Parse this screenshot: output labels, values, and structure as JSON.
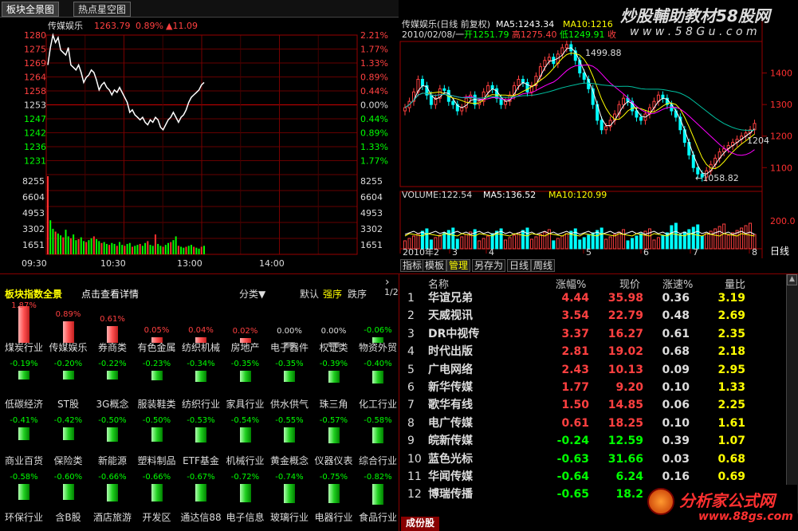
{
  "tabs": [
    "板块全景图",
    "热点星空图"
  ],
  "intraday": {
    "name": "传媒娱乐",
    "price": "1263.79",
    "pct": "0.89%",
    "change": "▲11.09",
    "price_ticks": [
      "1280",
      "1275",
      "1269",
      "1264",
      "1258",
      "1253",
      "1247",
      "1242",
      "1236",
      "1231"
    ],
    "pct_ticks": [
      "2.21%",
      "1.77%",
      "1.33%",
      "0.89%",
      "0.44%",
      "0.00%",
      "0.44%",
      "0.89%",
      "1.33%",
      "1.77%"
    ],
    "vol_ticks": [
      "8255",
      "6604",
      "4953",
      "3302",
      "1651"
    ],
    "time_ticks": [
      "09:30",
      "10:30",
      "13:00",
      "14:00"
    ],
    "price_series": [
      1270,
      1277,
      1282,
      1279,
      1281,
      1276,
      1275,
      1274,
      1277,
      1270,
      1269,
      1268,
      1270,
      1267,
      1263,
      1265,
      1266,
      1268,
      1267,
      1264,
      1260,
      1262,
      1263,
      1261,
      1260,
      1258,
      1260,
      1259,
      1261,
      1259,
      1257,
      1255,
      1251,
      1252,
      1250,
      1249,
      1248,
      1249,
      1247,
      1246,
      1248,
      1247,
      1249,
      1248,
      1245,
      1244,
      1246,
      1248,
      1249,
      1251,
      1249,
      1247,
      1249,
      1250,
      1252,
      1255,
      1257,
      1258,
      1259,
      1260,
      1262,
      1263
    ],
    "vol_series": [
      8255,
      3600,
      2700,
      2400,
      2200,
      2000,
      1800,
      2600,
      1900,
      1700,
      2100,
      1500,
      1600,
      1800,
      1400,
      1300,
      1500,
      1700,
      1900,
      1600,
      1400,
      1200,
      1300,
      1100,
      1000,
      1200,
      1100,
      900,
      1300,
      1000,
      900,
      1100,
      1200,
      800,
      900,
      1000,
      1100,
      900,
      1200,
      1400,
      1000,
      900,
      2100,
      1100,
      900,
      800,
      1000,
      1200,
      1300,
      1500,
      1900,
      900,
      800,
      700,
      800,
      900,
      1000,
      800,
      700,
      600,
      800,
      900
    ]
  },
  "daily": {
    "title": "传媒娱乐(日线 前复权)",
    "ma5": "MA5:1243.34",
    "ma10": "MA10:1216",
    "date_line": "2010/02/08/一",
    "open": "开1251.79",
    "high": "高1275.40",
    "low": "低1249.91",
    "close_lbl": "收",
    "high_note": "1499.88",
    "low_note": "←1058.82",
    "right_note": "1204",
    "y_ticks": [
      "1400",
      "1300",
      "1200",
      "1100"
    ],
    "vol_title": "VOLUME:122.54",
    "vol_ma5": "MA5:136.52",
    "vol_ma10": "MA10:120.99",
    "vol_tick": "200.0",
    "month_ticks": [
      "2010年2",
      "3",
      "4",
      "5",
      "6",
      "7",
      "8"
    ],
    "period_label": "日线",
    "candles": [
      1290,
      1310,
      1340,
      1380,
      1360,
      1330,
      1300,
      1320,
      1350,
      1345,
      1310,
      1300,
      1280,
      1290,
      1320,
      1330,
      1300,
      1310,
      1340,
      1360,
      1350,
      1320,
      1300,
      1310,
      1330,
      1360,
      1380,
      1370,
      1340,
      1360,
      1390,
      1420,
      1440,
      1450,
      1430,
      1460,
      1480,
      1490,
      1470,
      1440,
      1400,
      1380,
      1350,
      1300,
      1250,
      1220,
      1230,
      1250,
      1270,
      1300,
      1320,
      1310,
      1280,
      1260,
      1250,
      1270,
      1290,
      1310,
      1330,
      1320,
      1300,
      1280,
      1260,
      1220,
      1180,
      1140,
      1100,
      1080,
      1070,
      1090,
      1110,
      1130,
      1150,
      1160,
      1170,
      1180,
      1190,
      1200,
      1210,
      1220,
      1240
    ]
  },
  "bottom_tabs": [
    "指标",
    "模板",
    "管理",
    "另存为",
    "日线",
    "周线"
  ],
  "sector": {
    "title": "板块指数全景",
    "subtitle": "点击查看详情",
    "sort_label": "分类▼",
    "opt_default": "默认",
    "opt_strong": "强序",
    "opt_weak": "跌序",
    "page": "1/2",
    "arrow": "›",
    "tiles": [
      {
        "pct": "1.87%",
        "name": "煤炭行业",
        "v": 1.87
      },
      {
        "pct": "0.89%",
        "name": "传媒娱乐",
        "v": 0.89
      },
      {
        "pct": "0.61%",
        "name": "券商类",
        "v": 0.61
      },
      {
        "pct": "0.05%",
        "name": "有色金属",
        "v": 0.05
      },
      {
        "pct": "0.04%",
        "name": "纺织机械",
        "v": 0.04
      },
      {
        "pct": "0.02%",
        "name": "房地产",
        "v": 0.02
      },
      {
        "pct": "0.00%",
        "name": "电子器件",
        "v": 0.0
      },
      {
        "pct": "0.00%",
        "name": "权证类",
        "v": 0.0
      },
      {
        "pct": "-0.06%",
        "name": "物资外贸",
        "v": -0.06
      },
      {
        "pct": "-0.19%",
        "name": "低碳经济",
        "v": -0.19
      },
      {
        "pct": "-0.20%",
        "name": "ST股",
        "v": -0.2
      },
      {
        "pct": "-0.22%",
        "name": "3G概念",
        "v": -0.22
      },
      {
        "pct": "-0.23%",
        "name": "服装鞋类",
        "v": -0.23
      },
      {
        "pct": "-0.34%",
        "name": "纺织行业",
        "v": -0.34
      },
      {
        "pct": "-0.35%",
        "name": "家具行业",
        "v": -0.35
      },
      {
        "pct": "-0.35%",
        "name": "供水供气",
        "v": -0.35
      },
      {
        "pct": "-0.39%",
        "name": "珠三角",
        "v": -0.39
      },
      {
        "pct": "-0.40%",
        "name": "化工行业",
        "v": -0.4
      },
      {
        "pct": "-0.41%",
        "name": "商业百货",
        "v": -0.41
      },
      {
        "pct": "-0.42%",
        "name": "保险类",
        "v": -0.42
      },
      {
        "pct": "-0.50%",
        "name": "新能源",
        "v": -0.5
      },
      {
        "pct": "-0.50%",
        "name": "塑料制品",
        "v": -0.5
      },
      {
        "pct": "-0.53%",
        "name": "ETF基金",
        "v": -0.53
      },
      {
        "pct": "-0.54%",
        "name": "机械行业",
        "v": -0.54
      },
      {
        "pct": "-0.55%",
        "name": "黄金概念",
        "v": -0.55
      },
      {
        "pct": "-0.57%",
        "name": "仪器仪表",
        "v": -0.57
      },
      {
        "pct": "-0.58%",
        "name": "综合行业",
        "v": -0.58
      },
      {
        "pct": "-0.58%",
        "name": "环保行业",
        "v": -0.58
      },
      {
        "pct": "-0.60%",
        "name": "含B股",
        "v": -0.6
      },
      {
        "pct": "-0.66%",
        "name": "酒店旅游",
        "v": -0.66
      },
      {
        "pct": "-0.66%",
        "name": "开发区",
        "v": -0.66
      },
      {
        "pct": "-0.67%",
        "name": "通达信88",
        "v": -0.67
      },
      {
        "pct": "-0.72%",
        "name": "电子信息",
        "v": -0.72
      },
      {
        "pct": "-0.74%",
        "name": "玻璃行业",
        "v": -0.74
      },
      {
        "pct": "-0.75%",
        "name": "电器行业",
        "v": -0.75
      },
      {
        "pct": "-0.82%",
        "name": "食品行业",
        "v": -0.82
      }
    ]
  },
  "stocks": {
    "headers": [
      "名称",
      "涨幅%",
      "现价",
      "涨速%",
      "量比"
    ],
    "rows": [
      {
        "idx": "1",
        "name": "华谊兄弟",
        "chg": "4.44",
        "price": "35.98",
        "speed": "0.36",
        "ratio": "3.19",
        "up": true
      },
      {
        "idx": "2",
        "name": "天威视讯",
        "chg": "3.54",
        "price": "22.79",
        "speed": "0.48",
        "ratio": "2.69",
        "up": true
      },
      {
        "idx": "3",
        "name": "DR中视传",
        "chg": "3.37",
        "price": "16.27",
        "speed": "0.61",
        "ratio": "2.35",
        "up": true
      },
      {
        "idx": "4",
        "name": "时代出版",
        "chg": "2.81",
        "price": "19.02",
        "speed": "0.68",
        "ratio": "2.18",
        "up": true
      },
      {
        "idx": "5",
        "name": "广电网络",
        "chg": "2.43",
        "price": "10.13",
        "speed": "0.09",
        "ratio": "2.95",
        "up": true
      },
      {
        "idx": "6",
        "name": "新华传媒",
        "chg": "1.77",
        "price": "9.20",
        "speed": "0.10",
        "ratio": "1.33",
        "up": true
      },
      {
        "idx": "7",
        "name": "歌华有线",
        "chg": "1.50",
        "price": "14.85",
        "speed": "0.06",
        "ratio": "2.25",
        "up": true
      },
      {
        "idx": "8",
        "name": "电广传媒",
        "chg": "0.61",
        "price": "18.25",
        "speed": "0.10",
        "ratio": "1.61",
        "up": true
      },
      {
        "idx": "9",
        "name": "皖新传媒",
        "chg": "-0.24",
        "price": "12.59",
        "speed": "0.39",
        "ratio": "1.07",
        "up": false
      },
      {
        "idx": "10",
        "name": "蓝色光标",
        "chg": "-0.63",
        "price": "31.66",
        "speed": "0.03",
        "ratio": "0.68",
        "up": false
      },
      {
        "idx": "11",
        "name": "华闻传媒",
        "chg": "-0.64",
        "price": "6.24",
        "speed": "0.16",
        "ratio": "0.69",
        "up": false
      },
      {
        "idx": "12",
        "name": "博瑞传播",
        "chg": "-0.65",
        "price": "18.2",
        "speed": "",
        "ratio": "",
        "up": false
      }
    ],
    "bottom_tab": "成份股"
  },
  "watermark": {
    "top": "炒股輔助教材58股网",
    "top_url": "w w w . 5 8 G u . c o m",
    "bottom": "分析家公式网",
    "bottom_url": "www.88gs.com"
  },
  "colors": {
    "up": "#ff4040",
    "down": "#00ff00",
    "grid": "#800000",
    "axis_red": "#ff3030"
  }
}
